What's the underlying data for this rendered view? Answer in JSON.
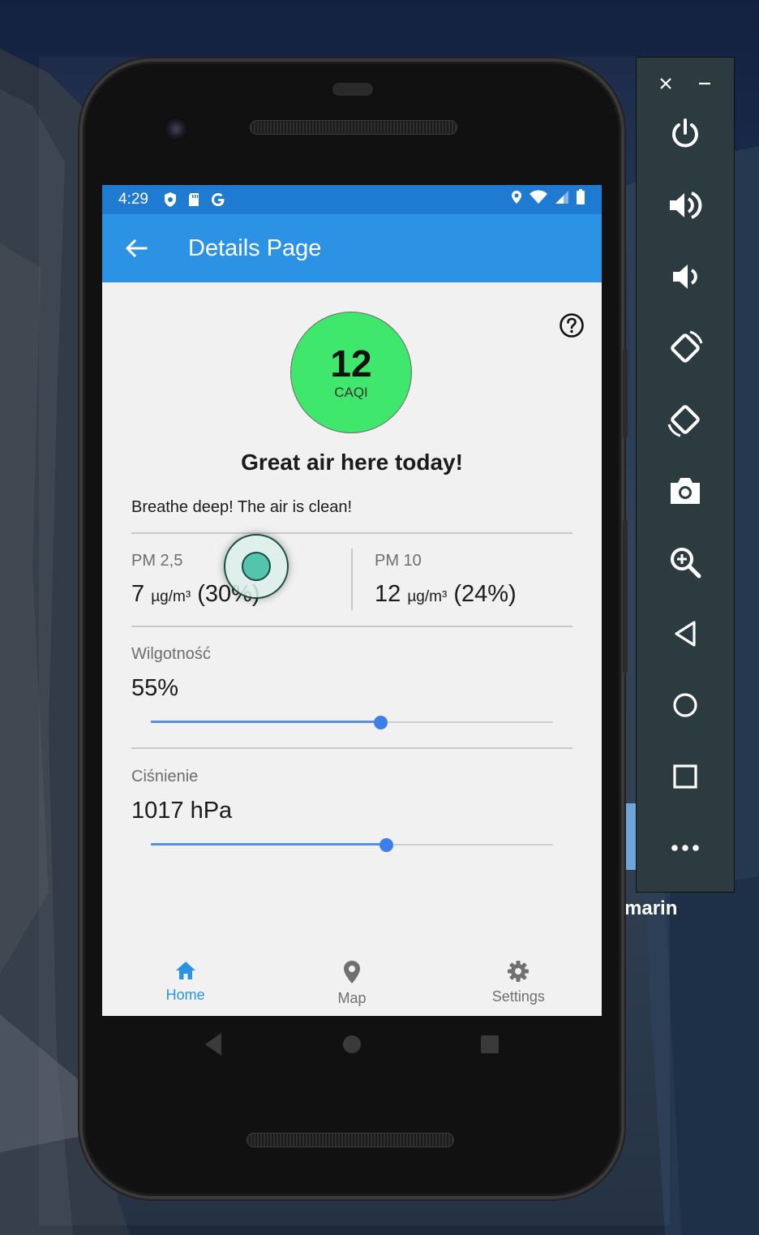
{
  "desktop": {
    "label_partial": "marin"
  },
  "status_bar": {
    "time": "4:29"
  },
  "app_bar": {
    "title": "Details Page"
  },
  "caqi": {
    "value": "12",
    "label": "CAQI",
    "color": "#3fe76c"
  },
  "headline": "Great air here today!",
  "description": "Breathe deep! The air is clean!",
  "pm": [
    {
      "label": "PM 2,5",
      "value": "7",
      "unit": "µg/m³",
      "percent": "(30%)"
    },
    {
      "label": "PM 10",
      "value": "12",
      "unit": "µg/m³",
      "percent": "(24%)"
    }
  ],
  "humidity": {
    "label": "Wilgotność",
    "value": "55%",
    "slider_fraction": 0.57
  },
  "pressure": {
    "label": "Ciśnienie",
    "value": "1017 hPa",
    "slider_fraction": 0.585
  },
  "bottom_nav": {
    "items": [
      {
        "label": "Home",
        "icon": "home-icon",
        "active": true
      },
      {
        "label": "Map",
        "icon": "map-pin-icon",
        "active": false
      },
      {
        "label": "Settings",
        "icon": "gear-icon",
        "active": false
      }
    ]
  },
  "colors": {
    "primary": "#2b92e4",
    "status_bar": "#1e7bd1",
    "active_nav": "#2b92e4",
    "inactive_nav": "#707070"
  },
  "emulator_panel": {
    "buttons": [
      "power-icon",
      "volume-up-icon",
      "volume-down-icon",
      "rotate-left-icon",
      "rotate-right-icon",
      "camera-icon",
      "zoom-icon",
      "back-icon",
      "home-circle-icon",
      "overview-icon",
      "more-icon"
    ]
  }
}
